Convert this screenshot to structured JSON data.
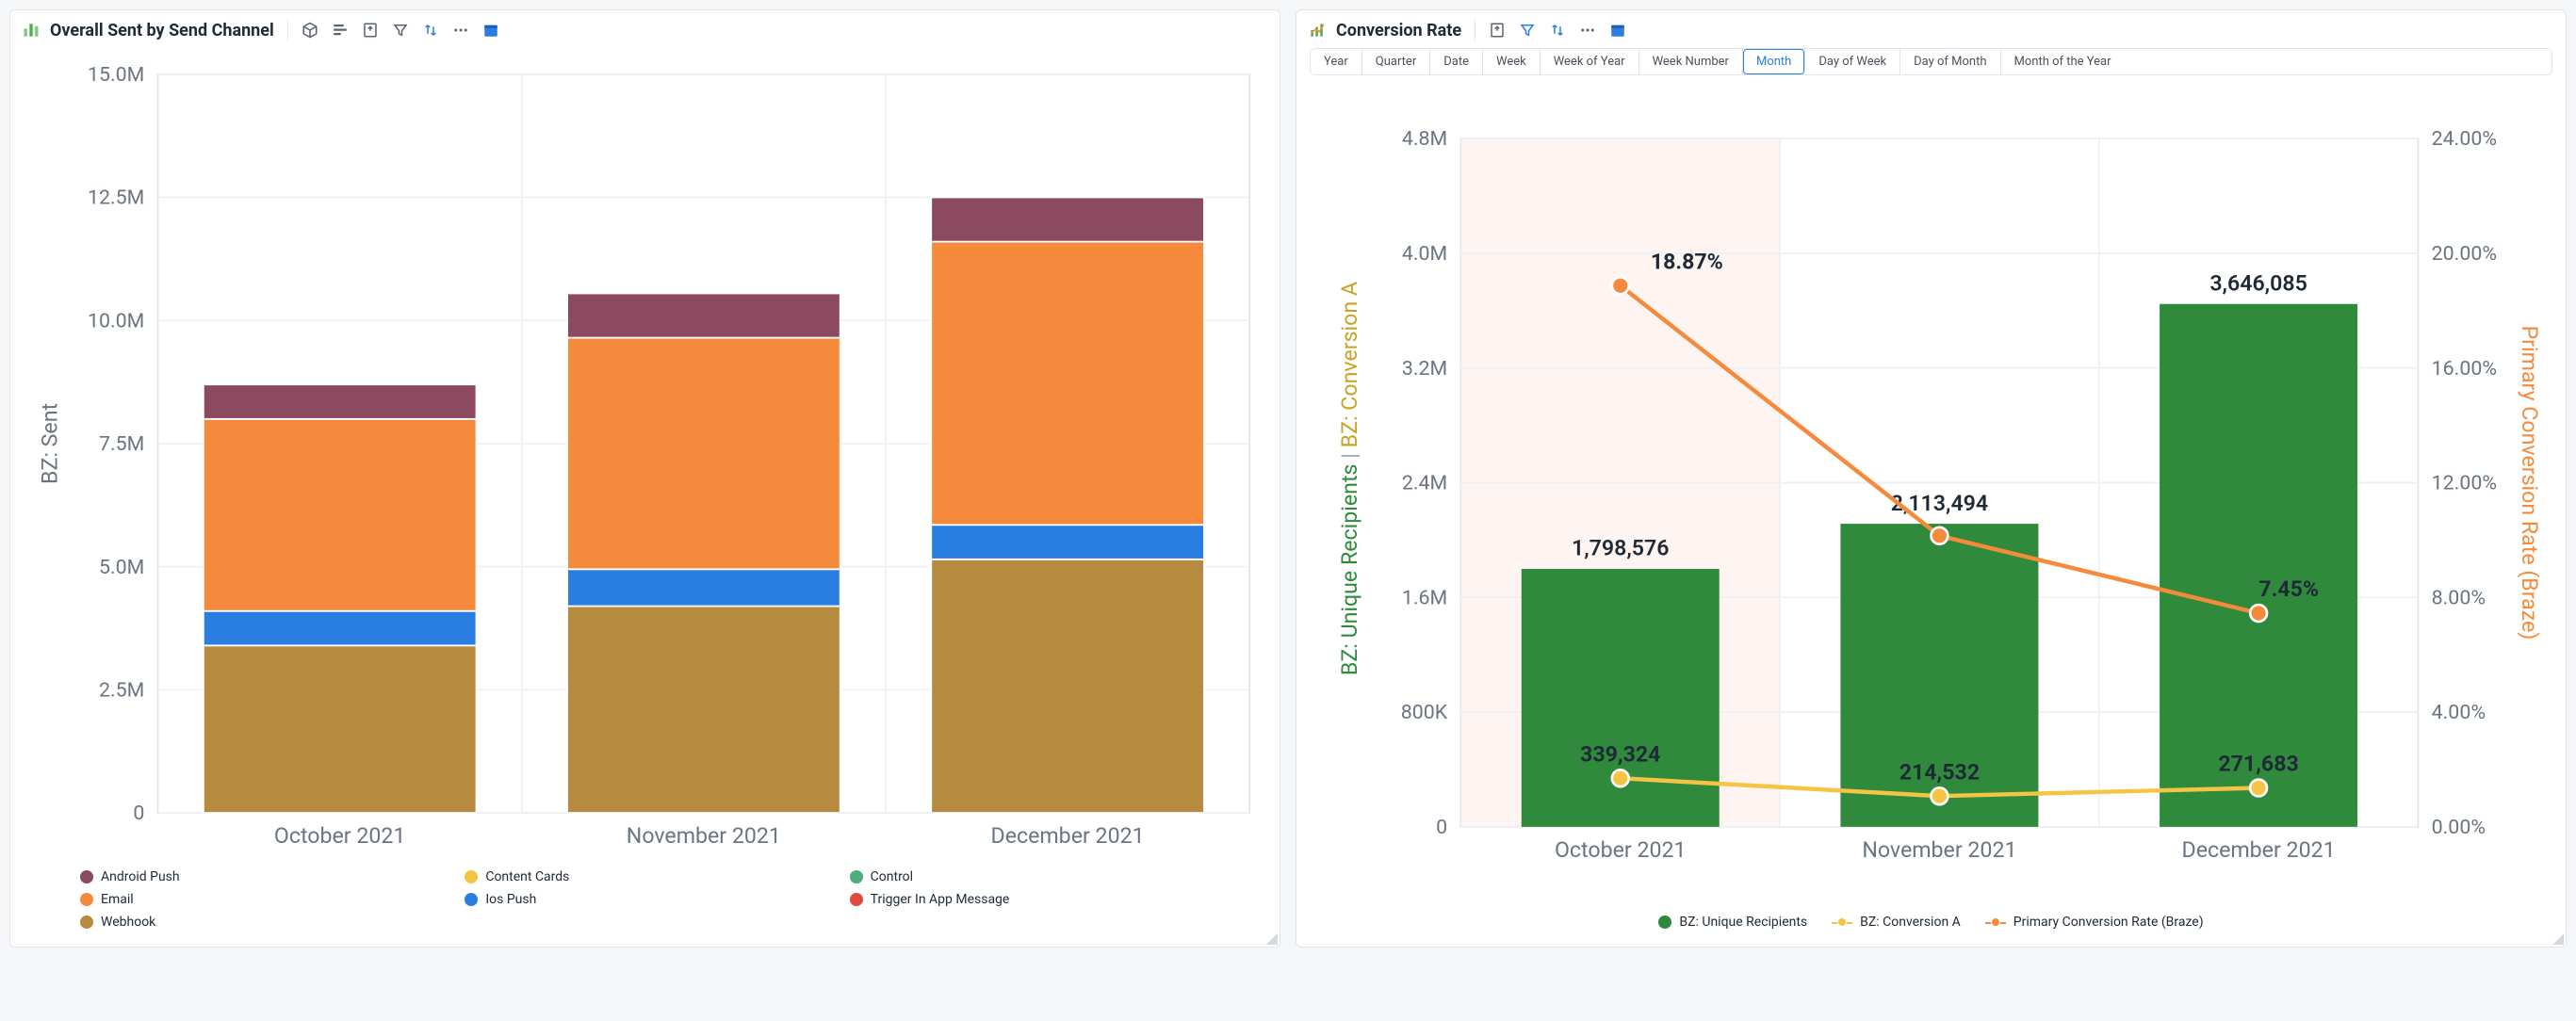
{
  "left_panel": {
    "title": "Overall Sent by Send Channel",
    "y_axis_label": "BZ: Sent",
    "legend": [
      {
        "name": "Android Push",
        "color": "#8b4a5f"
      },
      {
        "name": "Content Cards",
        "color": "#f6c444"
      },
      {
        "name": "Control",
        "color": "#4cae7a"
      },
      {
        "name": "Email",
        "color": "#f58a3c"
      },
      {
        "name": "Ios Push",
        "color": "#2a7de1"
      },
      {
        "name": "Trigger In App Message",
        "color": "#e04b3c"
      },
      {
        "name": "Webhook",
        "color": "#b78b3f"
      }
    ]
  },
  "right_panel": {
    "title": "Conversion Rate",
    "granularity": [
      "Year",
      "Quarter",
      "Date",
      "Week",
      "Week of Year",
      "Week Number",
      "Month",
      "Day of Week",
      "Day of Month",
      "Month of the Year"
    ],
    "granularity_active": "Month",
    "y_axis_left_1": "BZ: Unique Recipients",
    "y_axis_left_2": "BZ: Conversion A",
    "y_axis_right": "Primary Conversion Rate (Braze)",
    "legend": [
      {
        "name": "BZ: Unique Recipients",
        "color": "#2f8a3c",
        "shape": "circle"
      },
      {
        "name": "BZ: Conversion A",
        "color": "#f6c444",
        "shape": "line"
      },
      {
        "name": "Primary Conversion Rate (Braze)",
        "color": "#f58a3c",
        "shape": "line"
      }
    ],
    "bar_labels": [
      "1,798,576",
      "2,113,494",
      "3,646,085"
    ],
    "conv_a_labels": [
      "339,324",
      "214,532",
      "271,683"
    ],
    "rate_labels": [
      "18.87%",
      "",
      "7.45%"
    ]
  },
  "chart_data": [
    {
      "type": "bar",
      "stacked": true,
      "title": "Overall Sent by Send Channel",
      "ylabel": "BZ: Sent",
      "categories": [
        "October 2021",
        "November 2021",
        "December 2021"
      ],
      "ylim": [
        0,
        15000000
      ],
      "yticks": [
        0,
        2500000,
        5000000,
        7500000,
        10000000,
        12500000,
        15000000
      ],
      "ytick_labels": [
        "0",
        "2.5M",
        "5.0M",
        "7.5M",
        "10.0M",
        "12.5M",
        "15.0M"
      ],
      "series": [
        {
          "name": "Webhook",
          "color": "#b78b3f",
          "values": [
            3400000,
            4200000,
            5150000
          ]
        },
        {
          "name": "Ios Push",
          "color": "#2a7de1",
          "values": [
            700000,
            750000,
            700000
          ]
        },
        {
          "name": "Email",
          "color": "#f58a3c",
          "values": [
            3900000,
            4700000,
            5750000
          ]
        },
        {
          "name": "Android Push",
          "color": "#8b4a5f",
          "values": [
            700000,
            900000,
            900000
          ]
        },
        {
          "name": "Content Cards",
          "color": "#f6c444",
          "values": [
            0,
            0,
            0
          ]
        },
        {
          "name": "Control",
          "color": "#4cae7a",
          "values": [
            0,
            0,
            0
          ]
        },
        {
          "name": "Trigger In App Message",
          "color": "#e04b3c",
          "values": [
            0,
            0,
            0
          ]
        }
      ]
    },
    {
      "type": "combo",
      "title": "Conversion Rate",
      "categories": [
        "October 2021",
        "November 2021",
        "December 2021"
      ],
      "left_axis": {
        "label": "BZ: Unique Recipients | BZ: Conversion A",
        "lim": [
          0,
          4800000
        ],
        "ticks": [
          0,
          800000,
          1600000,
          2400000,
          3200000,
          4000000,
          4800000
        ],
        "tick_labels": [
          "0",
          "800K",
          "1.6M",
          "2.4M",
          "3.2M",
          "4.0M",
          "4.8M"
        ]
      },
      "right_axis": {
        "label": "Primary Conversion Rate (Braze)",
        "lim": [
          0,
          24
        ],
        "ticks": [
          0,
          4,
          8,
          12,
          16,
          20,
          24
        ],
        "tick_labels": [
          "0.00%",
          "4.00%",
          "8.00%",
          "12.00%",
          "16.00%",
          "20.00%",
          "24.00%"
        ]
      },
      "series": [
        {
          "name": "BZ: Unique Recipients",
          "type": "bar",
          "axis": "left",
          "color": "#2f8a3c",
          "values": [
            1798576,
            2113494,
            3646085
          ]
        },
        {
          "name": "BZ: Conversion A",
          "type": "line",
          "axis": "left",
          "color": "#f6c444",
          "values": [
            339324,
            214532,
            271683
          ]
        },
        {
          "name": "Primary Conversion Rate (Braze)",
          "type": "line",
          "axis": "right",
          "color": "#f58a3c",
          "values": [
            18.87,
            10.15,
            7.45
          ]
        }
      ]
    }
  ]
}
